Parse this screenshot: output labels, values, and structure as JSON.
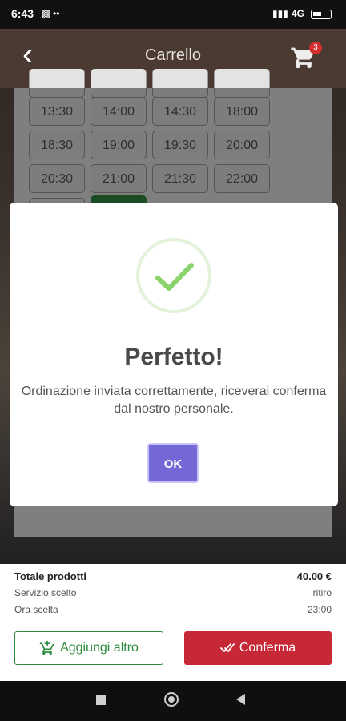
{
  "status_bar": {
    "time": "6:43",
    "network": "4G",
    "icons": [
      "notification-icon",
      "dots-icon",
      "signal-icon",
      "battery-icon"
    ]
  },
  "app_bar": {
    "back_icon": "chevron-left-icon",
    "title": "Carrello",
    "cart_icon": "cart-icon",
    "cart_badge": "3"
  },
  "time_slots": [
    [
      "13:30",
      "14:00",
      "14:30",
      "18:00"
    ],
    [
      "18:30",
      "19:00",
      "19:30",
      "20:00"
    ],
    [
      "20:30",
      "21:00",
      "21:30",
      "22:00"
    ]
  ],
  "dialog": {
    "heading": "Perfetto!",
    "message": "Ordinazione inviata correttamente, riceverai conferma dal nostro personale.",
    "ok_label": "OK",
    "success_color": "#8bd46d",
    "button_color": "#7467d6"
  },
  "summary": {
    "totale_label": "Totale prodotti",
    "totale_value": "40.00 €",
    "servizio_label": "Servizio scelto",
    "servizio_value": "ritiro",
    "ora_label": "Ora scelta",
    "ora_value": "23:00"
  },
  "actions": {
    "add_label": "Aggiungi altro",
    "confirm_label": "Conferma",
    "add_color": "#2e8b3e",
    "confirm_color": "#c62835"
  }
}
